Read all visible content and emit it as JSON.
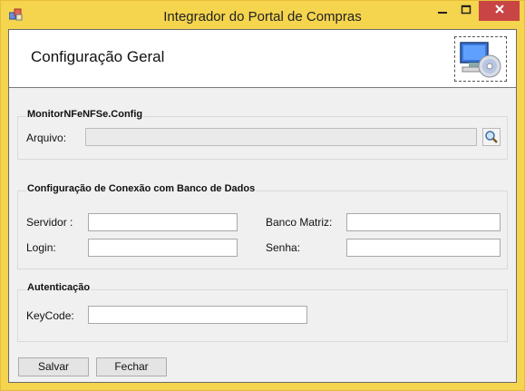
{
  "window": {
    "title": "Integrador do Portal de Compras"
  },
  "header": {
    "title": "Configuração Geral"
  },
  "group_file": {
    "title": "MonitorNFeNFSe.Config",
    "arquivo_label": "Arquivo:",
    "arquivo_value": ""
  },
  "group_db": {
    "title": "Configuração de Conexão com Banco de Dados",
    "servidor_label": "Servidor :",
    "servidor_value": "",
    "login_label": "Login:",
    "login_value": "",
    "banco_label": "Banco Matriz:",
    "banco_value": "",
    "senha_label": "Senha:",
    "senha_value": ""
  },
  "group_auth": {
    "title": "Autenticação",
    "keycode_label": "KeyCode:",
    "keycode_value": ""
  },
  "footer": {
    "salvar_label": "Salvar",
    "fechar_label": "Fechar"
  },
  "icons": [
    "app-icon",
    "minimize-icon",
    "maximize-icon",
    "close-icon",
    "computer-cd-icon",
    "search-icon"
  ]
}
